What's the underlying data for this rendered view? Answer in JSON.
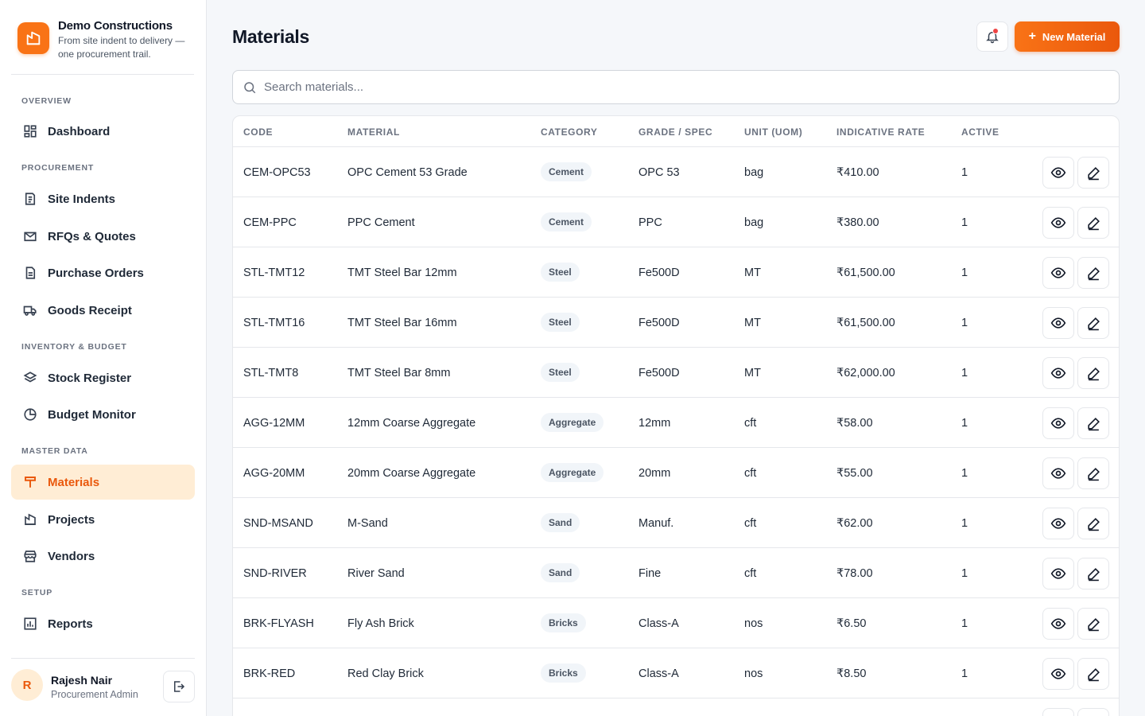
{
  "brand": {
    "name": "Demo Constructions",
    "tagline": "From site indent to delivery — one procurement trail."
  },
  "nav": {
    "sections": {
      "overview": "OVERVIEW",
      "procurement": "PROCUREMENT",
      "inventory": "INVENTORY & BUDGET",
      "master": "MASTER DATA",
      "setup": "SETUP"
    },
    "items": {
      "dashboard": "Dashboard",
      "site_indents": "Site Indents",
      "rfqs": "RFQs & Quotes",
      "purchase_orders": "Purchase Orders",
      "goods_receipt": "Goods Receipt",
      "stock_register": "Stock Register",
      "budget_monitor": "Budget Monitor",
      "materials": "Materials",
      "projects": "Projects",
      "vendors": "Vendors",
      "reports": "Reports"
    },
    "active": "materials"
  },
  "user": {
    "initial": "R",
    "name": "Rajesh Nair",
    "role": "Procurement Admin"
  },
  "header": {
    "title": "Materials",
    "new_button_plus": "+",
    "new_button_label": "New Material"
  },
  "search": {
    "placeholder": "Search materials..."
  },
  "table": {
    "columns": {
      "code": "CODE",
      "material": "MATERIAL",
      "category": "CATEGORY",
      "grade": "GRADE / SPEC",
      "unit": "UNIT (UOM)",
      "rate": "INDICATIVE RATE",
      "active": "ACTIVE"
    },
    "rows": [
      {
        "code": "CEM-OPC53",
        "material": "OPC Cement 53 Grade",
        "category": "Cement",
        "grade": "OPC 53",
        "unit": "bag",
        "rate": "₹410.00",
        "active": "1"
      },
      {
        "code": "CEM-PPC",
        "material": "PPC Cement",
        "category": "Cement",
        "grade": "PPC",
        "unit": "bag",
        "rate": "₹380.00",
        "active": "1"
      },
      {
        "code": "STL-TMT12",
        "material": "TMT Steel Bar 12mm",
        "category": "Steel",
        "grade": "Fe500D",
        "unit": "MT",
        "rate": "₹61,500.00",
        "active": "1"
      },
      {
        "code": "STL-TMT16",
        "material": "TMT Steel Bar 16mm",
        "category": "Steel",
        "grade": "Fe500D",
        "unit": "MT",
        "rate": "₹61,500.00",
        "active": "1"
      },
      {
        "code": "STL-TMT8",
        "material": "TMT Steel Bar 8mm",
        "category": "Steel",
        "grade": "Fe500D",
        "unit": "MT",
        "rate": "₹62,000.00",
        "active": "1"
      },
      {
        "code": "AGG-12MM",
        "material": "12mm Coarse Aggregate",
        "category": "Aggregate",
        "grade": "12mm",
        "unit": "cft",
        "rate": "₹58.00",
        "active": "1"
      },
      {
        "code": "AGG-20MM",
        "material": "20mm Coarse Aggregate",
        "category": "Aggregate",
        "grade": "20mm",
        "unit": "cft",
        "rate": "₹55.00",
        "active": "1"
      },
      {
        "code": "SND-MSAND",
        "material": "M-Sand",
        "category": "Sand",
        "grade": "Manuf.",
        "unit": "cft",
        "rate": "₹62.00",
        "active": "1"
      },
      {
        "code": "SND-RIVER",
        "material": "River Sand",
        "category": "Sand",
        "grade": "Fine",
        "unit": "cft",
        "rate": "₹78.00",
        "active": "1"
      },
      {
        "code": "BRK-FLYASH",
        "material": "Fly Ash Brick",
        "category": "Bricks",
        "grade": "Class-A",
        "unit": "nos",
        "rate": "₹6.50",
        "active": "1"
      },
      {
        "code": "BRK-RED",
        "material": "Red Clay Brick",
        "category": "Bricks",
        "grade": "Class-A",
        "unit": "nos",
        "rate": "₹8.50",
        "active": "1"
      }
    ]
  },
  "colors": {
    "accent": "#f97316",
    "accent_dark": "#ea580c",
    "active_bg": "#ffedd5"
  }
}
